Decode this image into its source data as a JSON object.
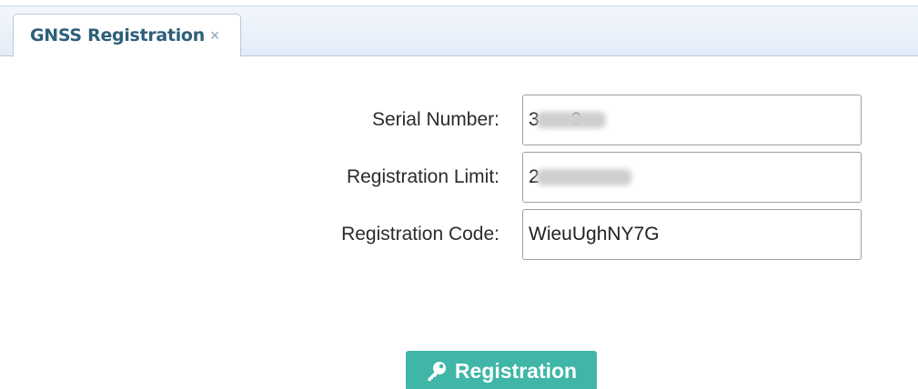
{
  "tabs": [
    {
      "label": "GNSS Registration",
      "close_glyph": "×",
      "active": true
    }
  ],
  "form": {
    "serial_number": {
      "label": "Serial Number:",
      "value": "3      9",
      "obscured": true
    },
    "registration_limit": {
      "label": "Registration Limit:",
      "value": "2",
      "obscured": true
    },
    "registration_code": {
      "label": "Registration Code:",
      "value": "WieuUghNY7G"
    }
  },
  "actions": {
    "register": {
      "label": "Registration",
      "icon": "key-icon",
      "color": "#3fb6a7"
    }
  },
  "colors": {
    "tab_text": "#2d5f79",
    "tab_bar": "#e3ecf7",
    "button": "#3fb6a7"
  }
}
